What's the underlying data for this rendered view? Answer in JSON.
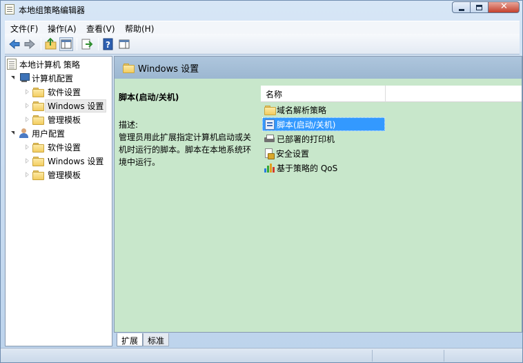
{
  "window": {
    "title": "本地组策略编辑器",
    "close_glyph": "✕"
  },
  "menu": {
    "items": [
      "文件(F)",
      "操作(A)",
      "查看(V)",
      "帮助(H)"
    ]
  },
  "tree": {
    "root": "本地计算机 策略",
    "computer_config": {
      "label": "计算机配置",
      "children": [
        "软件设置",
        "Windows 设置",
        "管理模板"
      ]
    },
    "user_config": {
      "label": "用户配置",
      "children": [
        "软件设置",
        "Windows 设置",
        "管理模板"
      ]
    }
  },
  "right_pane": {
    "header_title": "Windows 设置",
    "selected_title": "脚本(启动/关机)",
    "description_label": "描述:",
    "description_text": "管理员用此扩展指定计算机启动或关机时运行的脚本。脚本在本地系统环境中运行。",
    "column_name": "名称",
    "items": [
      {
        "label": "域名解析策略",
        "icon": "folder-icon"
      },
      {
        "label": "脚本(启动/关机)",
        "icon": "script-icon"
      },
      {
        "label": "已部署的打印机",
        "icon": "printer-icon"
      },
      {
        "label": "安全设置",
        "icon": "security-icon"
      },
      {
        "label": "基于策略的 QoS",
        "icon": "qos-icon"
      }
    ]
  },
  "tabs": {
    "extended": "扩展",
    "standard": "标准"
  },
  "colors": {
    "pane_background": "#c8e7cb",
    "selection": "#3399ff",
    "header_band": "#a6c0d9"
  }
}
